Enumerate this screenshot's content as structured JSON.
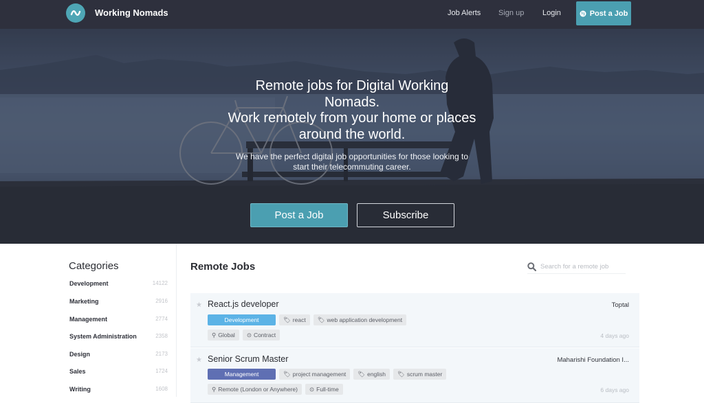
{
  "nav": {
    "brand": "Working Nomads",
    "links": [
      {
        "label": "Job Alerts"
      },
      {
        "label": "Sign up"
      },
      {
        "label": "Login"
      }
    ],
    "post_job_label": "Post a Job",
    "post_job_icon": "globe-icon",
    "logo_icon": "wave-logo-icon"
  },
  "hero": {
    "title_lines": [
      "Remote jobs for Digital Working",
      "Nomads.",
      "Work remotely from your home or places",
      "around the world."
    ],
    "subtitle_lines": [
      "We have the perfect digital job opportunities for those looking to",
      "start their telecommuting career."
    ],
    "post_job_label": "Post a Job",
    "subscribe_label": "Subscribe"
  },
  "sidebar": {
    "title": "Categories",
    "categories": [
      {
        "name": "Development",
        "count": "14122"
      },
      {
        "name": "Marketing",
        "count": "2916"
      },
      {
        "name": "Management",
        "count": "2774"
      },
      {
        "name": "System Administration",
        "count": "2358"
      },
      {
        "name": "Design",
        "count": "2173"
      },
      {
        "name": "Sales",
        "count": "1724"
      },
      {
        "name": "Writing",
        "count": "1608"
      }
    ]
  },
  "main": {
    "title": "Remote Jobs",
    "search_placeholder": "Search for a remote job",
    "jobs": [
      {
        "title": "React.js developer",
        "company": "Toptal",
        "category": "Development",
        "category_color": "#5cb3e6",
        "tags": [
          "react",
          "web application development"
        ],
        "location": "Global",
        "type": "Contract",
        "posted": "4 days ago"
      },
      {
        "title": "Senior Scrum Master",
        "company": "Maharishi Foundation I...",
        "category": "Management",
        "category_color": "#5f6fb3",
        "tags": [
          "project management",
          "english",
          "scrum master"
        ],
        "location": "Remote (London or Anywhere)",
        "type": "Full-time",
        "posted": "6 days ago"
      }
    ]
  },
  "colors": {
    "nav_bg": "#2e303d",
    "accent": "#4b9fb1"
  }
}
